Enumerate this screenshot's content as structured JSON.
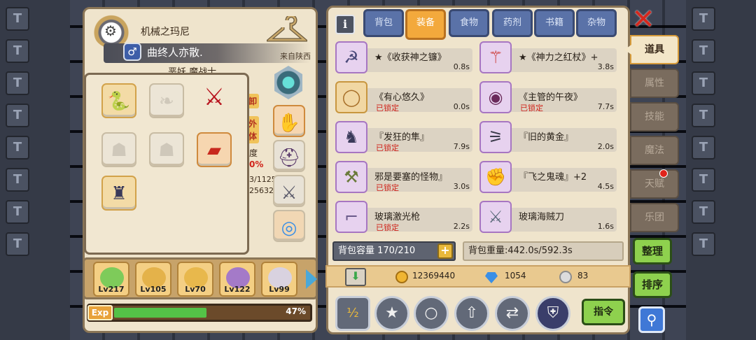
{
  "character": {
    "title": "机械之玛尼",
    "player_name": "曲终人亦散.",
    "from": "来自陕西",
    "class_title": "恶妖 魔战士",
    "side_label_1": "卸",
    "side_label_2": "外",
    "side_label_3": "体",
    "side_label_4": "度",
    "side_label_5": "0%",
    "side_label_6": "3/1125",
    "side_label_7": "25632",
    "gender_icon": "male-icon"
  },
  "party": [
    {
      "level": "Lv217"
    },
    {
      "level": "Lv105"
    },
    {
      "level": "Lv70"
    },
    {
      "level": "Lv122"
    },
    {
      "level": "Lv99"
    }
  ],
  "exp": {
    "label": "Exp",
    "percent": 47,
    "percent_text": "47%"
  },
  "tabs": [
    {
      "label": "背包",
      "active": false
    },
    {
      "label": "装备",
      "active": true
    },
    {
      "label": "食物",
      "active": false
    },
    {
      "label": "药剂",
      "active": false
    },
    {
      "label": "书籍",
      "active": false
    },
    {
      "label": "杂物",
      "active": false
    }
  ],
  "items": [
    {
      "name": "★《收获神之镰》",
      "locked": "",
      "weight": "0.8s",
      "icon": "scythe-icon"
    },
    {
      "name": "★《神力之红杖》+",
      "locked": "",
      "weight": "3.8s",
      "icon": "red-staff-icon"
    },
    {
      "name": "《有心悠久》",
      "locked": "已锁定",
      "weight": "0.0s",
      "icon": "ring-icon"
    },
    {
      "name": "《主管的午夜》",
      "locked": "已锁定",
      "weight": "7.7s",
      "icon": "mask-icon"
    },
    {
      "name": "『发狂的隼』",
      "locked": "已锁定",
      "weight": "7.9s",
      "icon": "falcon-armor-icon"
    },
    {
      "name": "『旧的黄金』",
      "locked": "",
      "weight": "2.0s",
      "icon": "claw-icon"
    },
    {
      "name": "邪是要塞的怪物』",
      "locked": "已锁定",
      "weight": "3.0s",
      "icon": "mace-icon"
    },
    {
      "name": "『飞之鬼魂』+2",
      "locked": "",
      "weight": "4.5s",
      "icon": "gauntlet-icon"
    },
    {
      "name": "玻璃激光枪",
      "locked": "已锁定",
      "weight": "2.2s",
      "icon": "laser-gun-icon"
    },
    {
      "name": "玻璃海贼刀",
      "locked": "",
      "weight": "1.6s",
      "icon": "cutlass-icon"
    }
  ],
  "bag": {
    "capacity_text": "背包容量 170/210",
    "weight_text": "背包重量:442.0s/592.3s"
  },
  "currency": {
    "gold": "12369440",
    "gems": "1054",
    "silver": "83"
  },
  "actions": {
    "order_label": "指令"
  },
  "side_tabs": [
    {
      "label": "道具",
      "active": true
    },
    {
      "label": "属性",
      "active": false
    },
    {
      "label": "技能",
      "active": false
    },
    {
      "label": "魔法",
      "active": false
    },
    {
      "label": "天赋",
      "active": false,
      "badge": true
    },
    {
      "label": "乐团",
      "active": false
    }
  ],
  "right_buttons": {
    "sort_label": "整理",
    "arrange_label": "排序"
  }
}
